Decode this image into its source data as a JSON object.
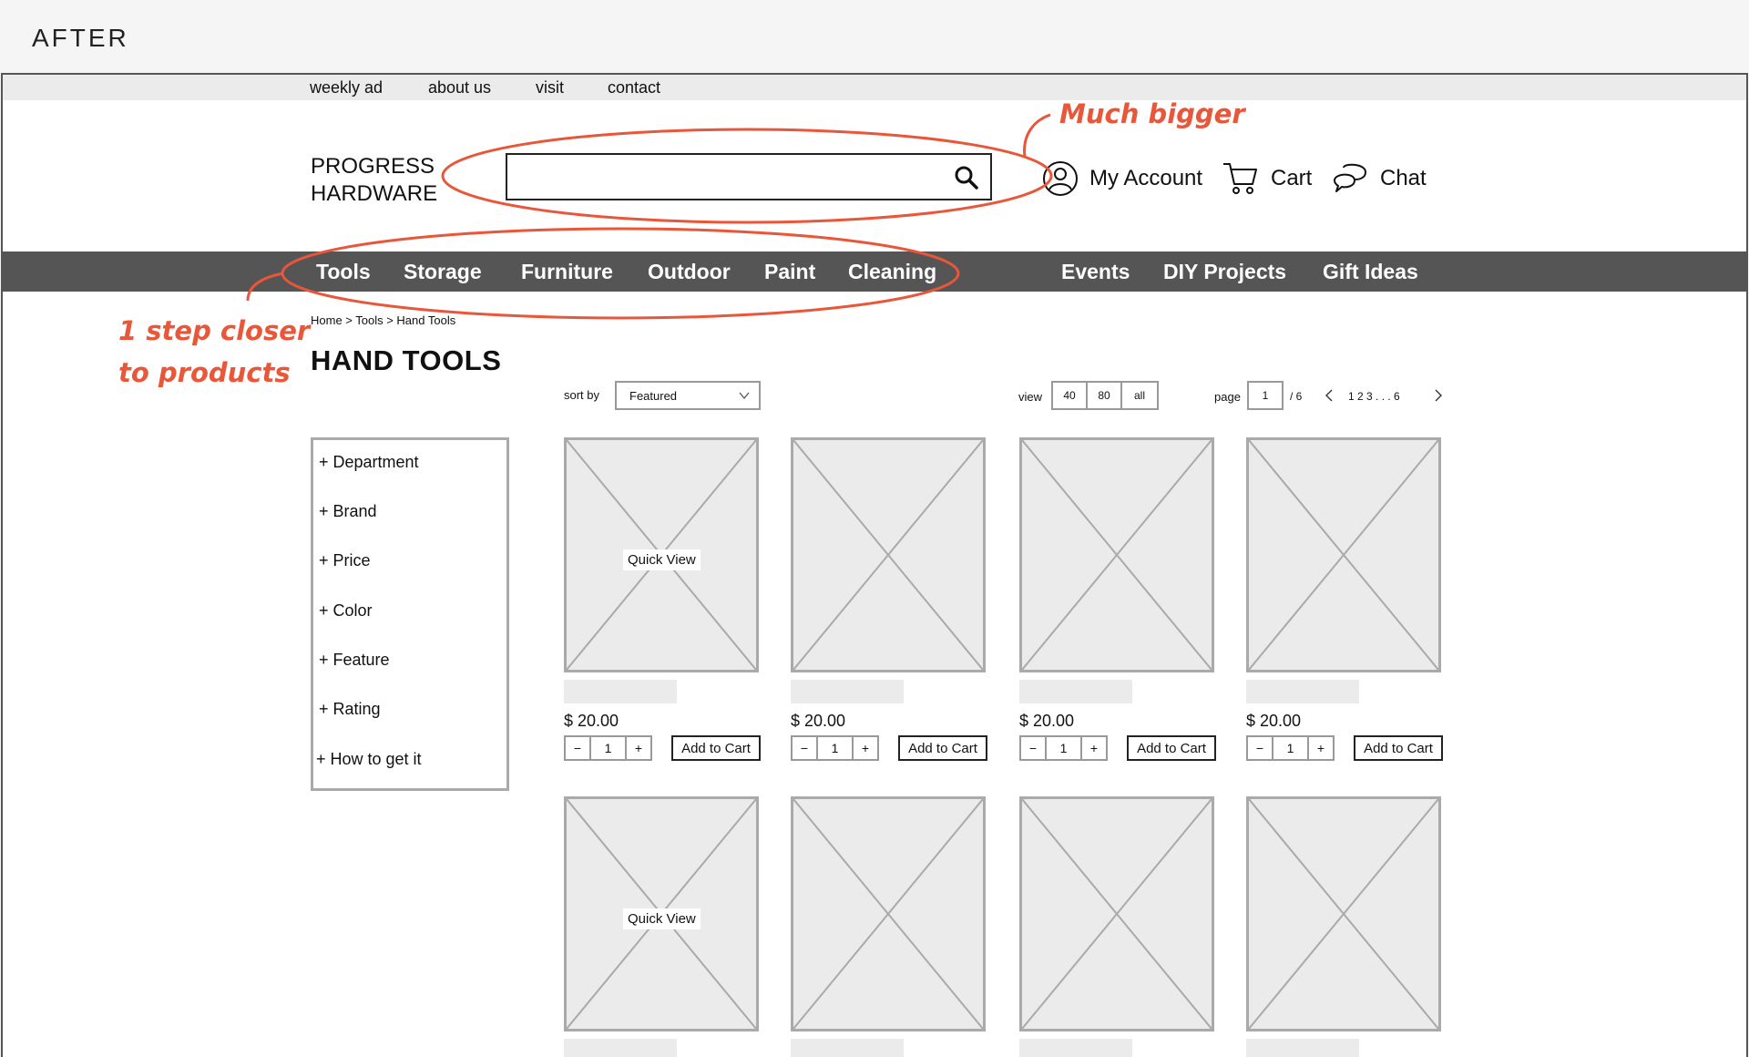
{
  "slide_label": "AFTER",
  "utility_nav": [
    "weekly ad",
    "about us",
    "visit",
    "contact"
  ],
  "logo": {
    "line1": "PROGRESS",
    "line2": "HARDWARE"
  },
  "search": {
    "value": "",
    "icon": "search-icon"
  },
  "header_links": {
    "account": "My Account",
    "cart": "Cart",
    "chat": "Chat"
  },
  "category_nav": [
    "Tools",
    "Storage",
    "Furniture",
    "Outdoor",
    "Paint",
    "Cleaning"
  ],
  "secondary_nav": [
    "Events",
    "DIY Projects",
    "Gift Ideas"
  ],
  "breadcrumb": "Home > Tools > Hand Tools",
  "page_title": "HAND TOOLS",
  "toolbar": {
    "sort_label": "sort by",
    "sort_value": "Featured",
    "view_label": "view",
    "view_options": [
      "40",
      "80",
      "all"
    ],
    "page_label": "page",
    "page_value": "1",
    "page_total": "/ 6",
    "page_links": "1 2 3 . . . 6"
  },
  "filters": [
    "+ Department",
    "+ Brand",
    "+ Price",
    "+ Color",
    "+ Feature",
    "+ Rating",
    "+ How to get it"
  ],
  "products": [
    {
      "price": "$ 20.00",
      "qty": "1",
      "add": "Add to Cart",
      "quick_view": "Quick View"
    },
    {
      "price": "$ 20.00",
      "qty": "1",
      "add": "Add to Cart",
      "quick_view": ""
    },
    {
      "price": "$ 20.00",
      "qty": "1",
      "add": "Add to Cart",
      "quick_view": ""
    },
    {
      "price": "$ 20.00",
      "qty": "1",
      "add": "Add to Cart",
      "quick_view": ""
    },
    {
      "price": "",
      "qty": "",
      "add": "",
      "quick_view": "Quick View"
    },
    {
      "price": "",
      "qty": "",
      "add": "",
      "quick_view": ""
    },
    {
      "price": "",
      "qty": "",
      "add": "",
      "quick_view": ""
    },
    {
      "price": "",
      "qty": "",
      "add": "",
      "quick_view": ""
    }
  ],
  "qty_controls": {
    "minus": "−",
    "plus": "+"
  },
  "annotations": {
    "search": "Much bigger",
    "nav_line1": "1 step closer",
    "nav_line2": "to products"
  },
  "colors": {
    "annotation": "#e8573a",
    "nav_bg": "#555555",
    "placeholder": "#ebebeb"
  }
}
